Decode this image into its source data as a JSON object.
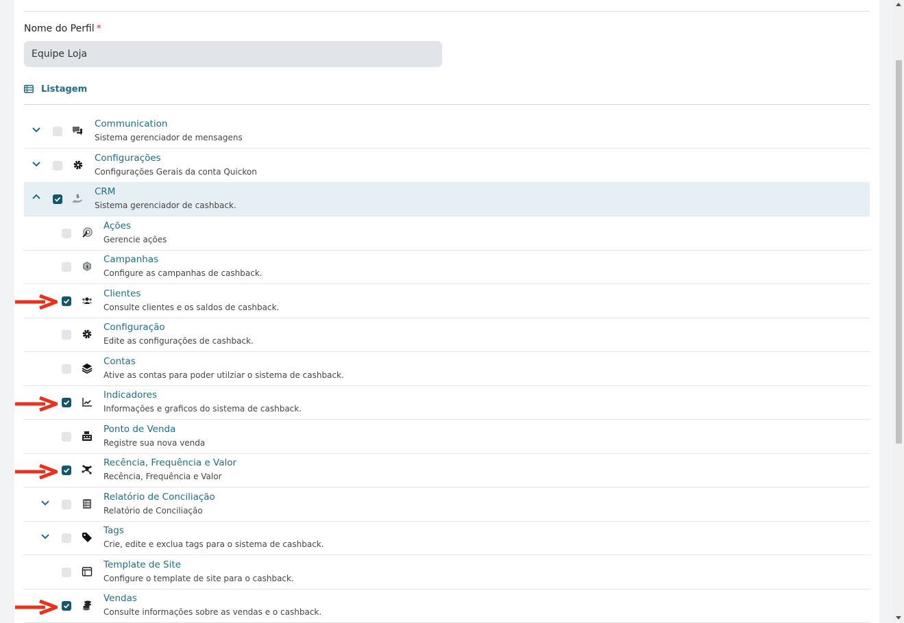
{
  "form": {
    "profile_label": "Nome do Perfil",
    "required_mark": "*",
    "profile_value": "Equipe Loja"
  },
  "section": {
    "title": "Listagem"
  },
  "colors": {
    "accent": "#1f6d86",
    "checked": "#14566b",
    "selected_row": "#e6eff4",
    "arrow": "#e8321e"
  },
  "modules": [
    {
      "title": "Communication",
      "desc": "Sistema gerenciador de mensagens",
      "icon": "chat-icon",
      "checked": false,
      "chevron": "down"
    },
    {
      "title": "Configurações",
      "desc": "Configurações Gerais da conta Quickon",
      "icon": "gear-icon",
      "checked": false,
      "chevron": "down"
    },
    {
      "title": "CRM",
      "desc": "Sistema gerenciador de cashback.",
      "icon": "cashback-hand-icon",
      "checked": true,
      "chevron": "up"
    }
  ],
  "crm_items": [
    {
      "title": "Ações",
      "desc": "Gerencie ações",
      "icon": "target-icon",
      "checked": false
    },
    {
      "title": "Campanhas",
      "desc": "Configure as campanhas de cashback.",
      "icon": "money-badge-icon",
      "checked": false
    },
    {
      "title": "Clientes",
      "desc": "Consulte clientes e os saldos de cashback.",
      "icon": "users-icon",
      "checked": true
    },
    {
      "title": "Configuração",
      "desc": "Edite as configurações de cashback.",
      "icon": "gear-icon",
      "checked": false
    },
    {
      "title": "Contas",
      "desc": "Ative as contas para poder utilziar o sistema de cashback.",
      "icon": "layers-icon",
      "checked": false
    },
    {
      "title": "Indicadores",
      "desc": "Informações e graficos do sistema de cashback.",
      "icon": "trend-chart-icon",
      "checked": true
    },
    {
      "title": "Ponto de Venda",
      "desc": "Registre sua nova venda",
      "icon": "cash-register-icon",
      "checked": false
    },
    {
      "title": "Recência, Frequência e Valor",
      "desc": "Recência, Frequência e Valor",
      "icon": "network-icon",
      "checked": true
    },
    {
      "title": "Relatório de Conciliação",
      "desc": "Relatório de Conciliação",
      "icon": "report-list-icon",
      "checked": false,
      "chevron": "down"
    },
    {
      "title": "Tags",
      "desc": "Crie, edite e exclua tags para o sistema de cashback.",
      "icon": "tag-icon",
      "checked": false,
      "chevron": "down"
    },
    {
      "title": "Template de Site",
      "desc": "Configure o template de site para o cashback.",
      "icon": "window-icon",
      "checked": false
    },
    {
      "title": "Vendas",
      "desc": "Consulte informações sobre as vendas e o cashback.",
      "icon": "coins-icon",
      "checked": true
    }
  ]
}
